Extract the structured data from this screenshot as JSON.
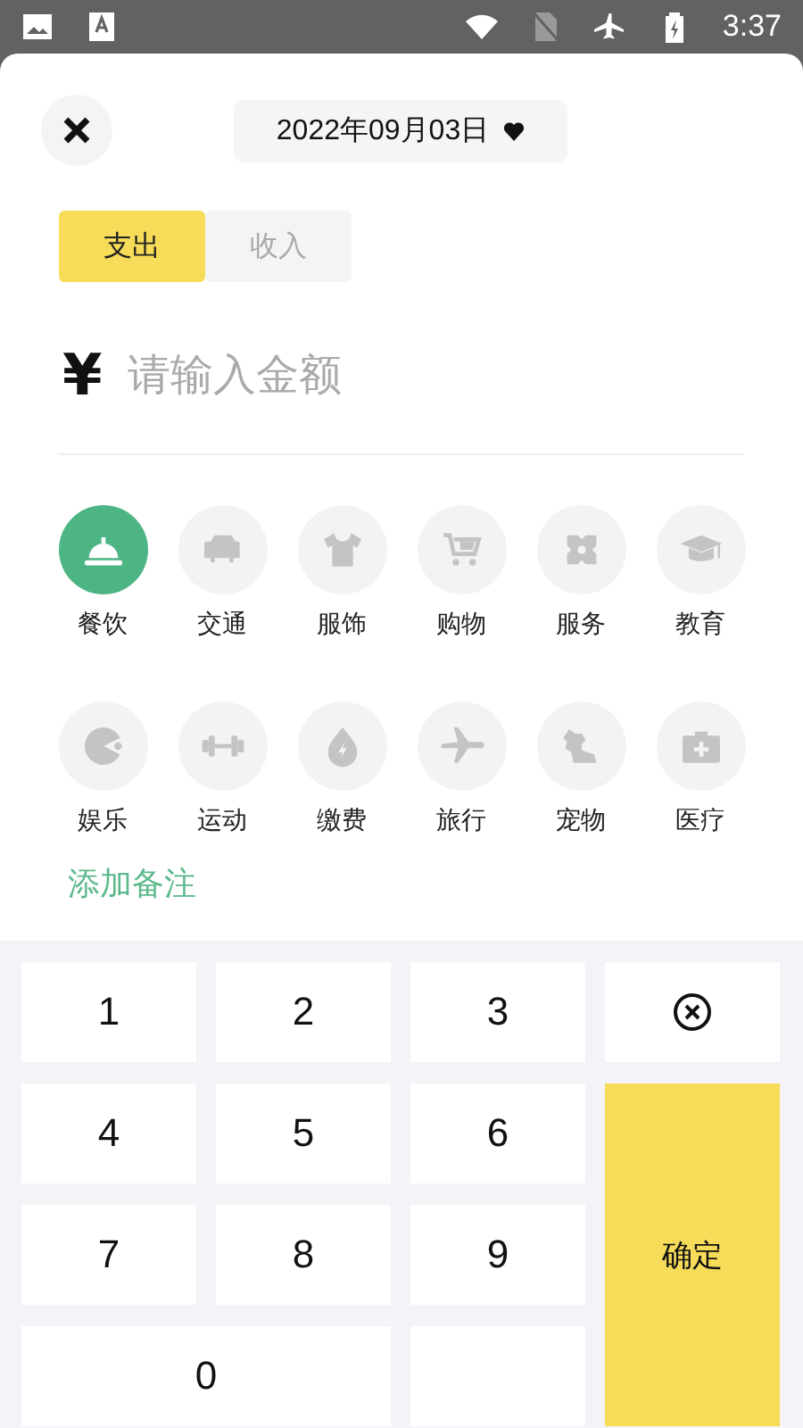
{
  "status_bar": {
    "time": "3:37"
  },
  "header": {
    "date": "2022年09月03日"
  },
  "tabs": [
    {
      "label": "支出",
      "selected": true
    },
    {
      "label": "收入",
      "selected": false
    }
  ],
  "amount": {
    "currency": "¥",
    "placeholder": "请输入金额"
  },
  "categories": [
    {
      "label": "餐饮",
      "selected": true
    },
    {
      "label": "交通",
      "selected": false
    },
    {
      "label": "服饰",
      "selected": false
    },
    {
      "label": "购物",
      "selected": false
    },
    {
      "label": "服务",
      "selected": false
    },
    {
      "label": "教育",
      "selected": false
    },
    {
      "label": "娱乐",
      "selected": false
    },
    {
      "label": "运动",
      "selected": false
    },
    {
      "label": "缴费",
      "selected": false
    },
    {
      "label": "旅行",
      "selected": false
    },
    {
      "label": "宠物",
      "selected": false
    },
    {
      "label": "医疗",
      "selected": false
    }
  ],
  "note_link": "添加备注",
  "keypad": [
    {
      "kind": "digit",
      "label": "1"
    },
    {
      "kind": "digit",
      "label": "2"
    },
    {
      "kind": "digit",
      "label": "3"
    },
    {
      "kind": "delete"
    },
    {
      "kind": "digit",
      "label": "4"
    },
    {
      "kind": "digit",
      "label": "5"
    },
    {
      "kind": "digit",
      "label": "6"
    },
    {
      "kind": "digit",
      "label": "7"
    },
    {
      "kind": "digit",
      "label": "8"
    },
    {
      "kind": "digit",
      "label": "9"
    },
    {
      "kind": "confirm",
      "label": "确定"
    },
    {
      "kind": "wide",
      "label": "0"
    },
    {
      "kind": "blank"
    }
  ]
}
